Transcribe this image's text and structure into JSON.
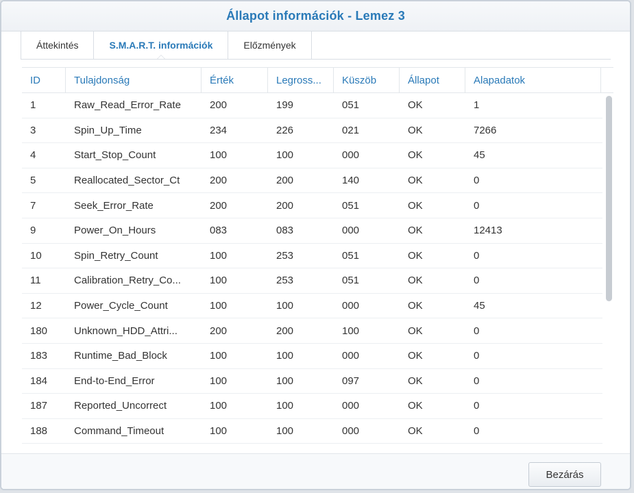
{
  "window": {
    "title": "Állapot információk - Lemez 3"
  },
  "tabs": [
    {
      "label": "Áttekintés",
      "active": false
    },
    {
      "label": "S.M.A.R.T. információk",
      "active": true
    },
    {
      "label": "Előzmények",
      "active": false
    }
  ],
  "table": {
    "columns": [
      "ID",
      "Tulajdonság",
      "Érték",
      "Legross...",
      "Küszöb",
      "Állapot",
      "Alapadatok"
    ],
    "rows": [
      [
        "1",
        "Raw_Read_Error_Rate",
        "200",
        "199",
        "051",
        "OK",
        "1"
      ],
      [
        "3",
        "Spin_Up_Time",
        "234",
        "226",
        "021",
        "OK",
        "7266"
      ],
      [
        "4",
        "Start_Stop_Count",
        "100",
        "100",
        "000",
        "OK",
        "45"
      ],
      [
        "5",
        "Reallocated_Sector_Ct",
        "200",
        "200",
        "140",
        "OK",
        "0"
      ],
      [
        "7",
        "Seek_Error_Rate",
        "200",
        "200",
        "051",
        "OK",
        "0"
      ],
      [
        "9",
        "Power_On_Hours",
        "083",
        "083",
        "000",
        "OK",
        "12413"
      ],
      [
        "10",
        "Spin_Retry_Count",
        "100",
        "253",
        "051",
        "OK",
        "0"
      ],
      [
        "11",
        "Calibration_Retry_Co...",
        "100",
        "253",
        "051",
        "OK",
        "0"
      ],
      [
        "12",
        "Power_Cycle_Count",
        "100",
        "100",
        "000",
        "OK",
        "45"
      ],
      [
        "180",
        "Unknown_HDD_Attri...",
        "200",
        "200",
        "100",
        "OK",
        "0"
      ],
      [
        "183",
        "Runtime_Bad_Block",
        "100",
        "100",
        "000",
        "OK",
        "0"
      ],
      [
        "184",
        "End-to-End_Error",
        "100",
        "100",
        "097",
        "OK",
        "0"
      ],
      [
        "187",
        "Reported_Uncorrect",
        "100",
        "100",
        "000",
        "OK",
        "0"
      ],
      [
        "188",
        "Command_Timeout",
        "100",
        "100",
        "000",
        "OK",
        "0"
      ]
    ]
  },
  "footer": {
    "close_label": "Bezárás"
  },
  "colors": {
    "accent": "#2a7ab8",
    "text": "#333333",
    "border": "#e2e6ea"
  }
}
